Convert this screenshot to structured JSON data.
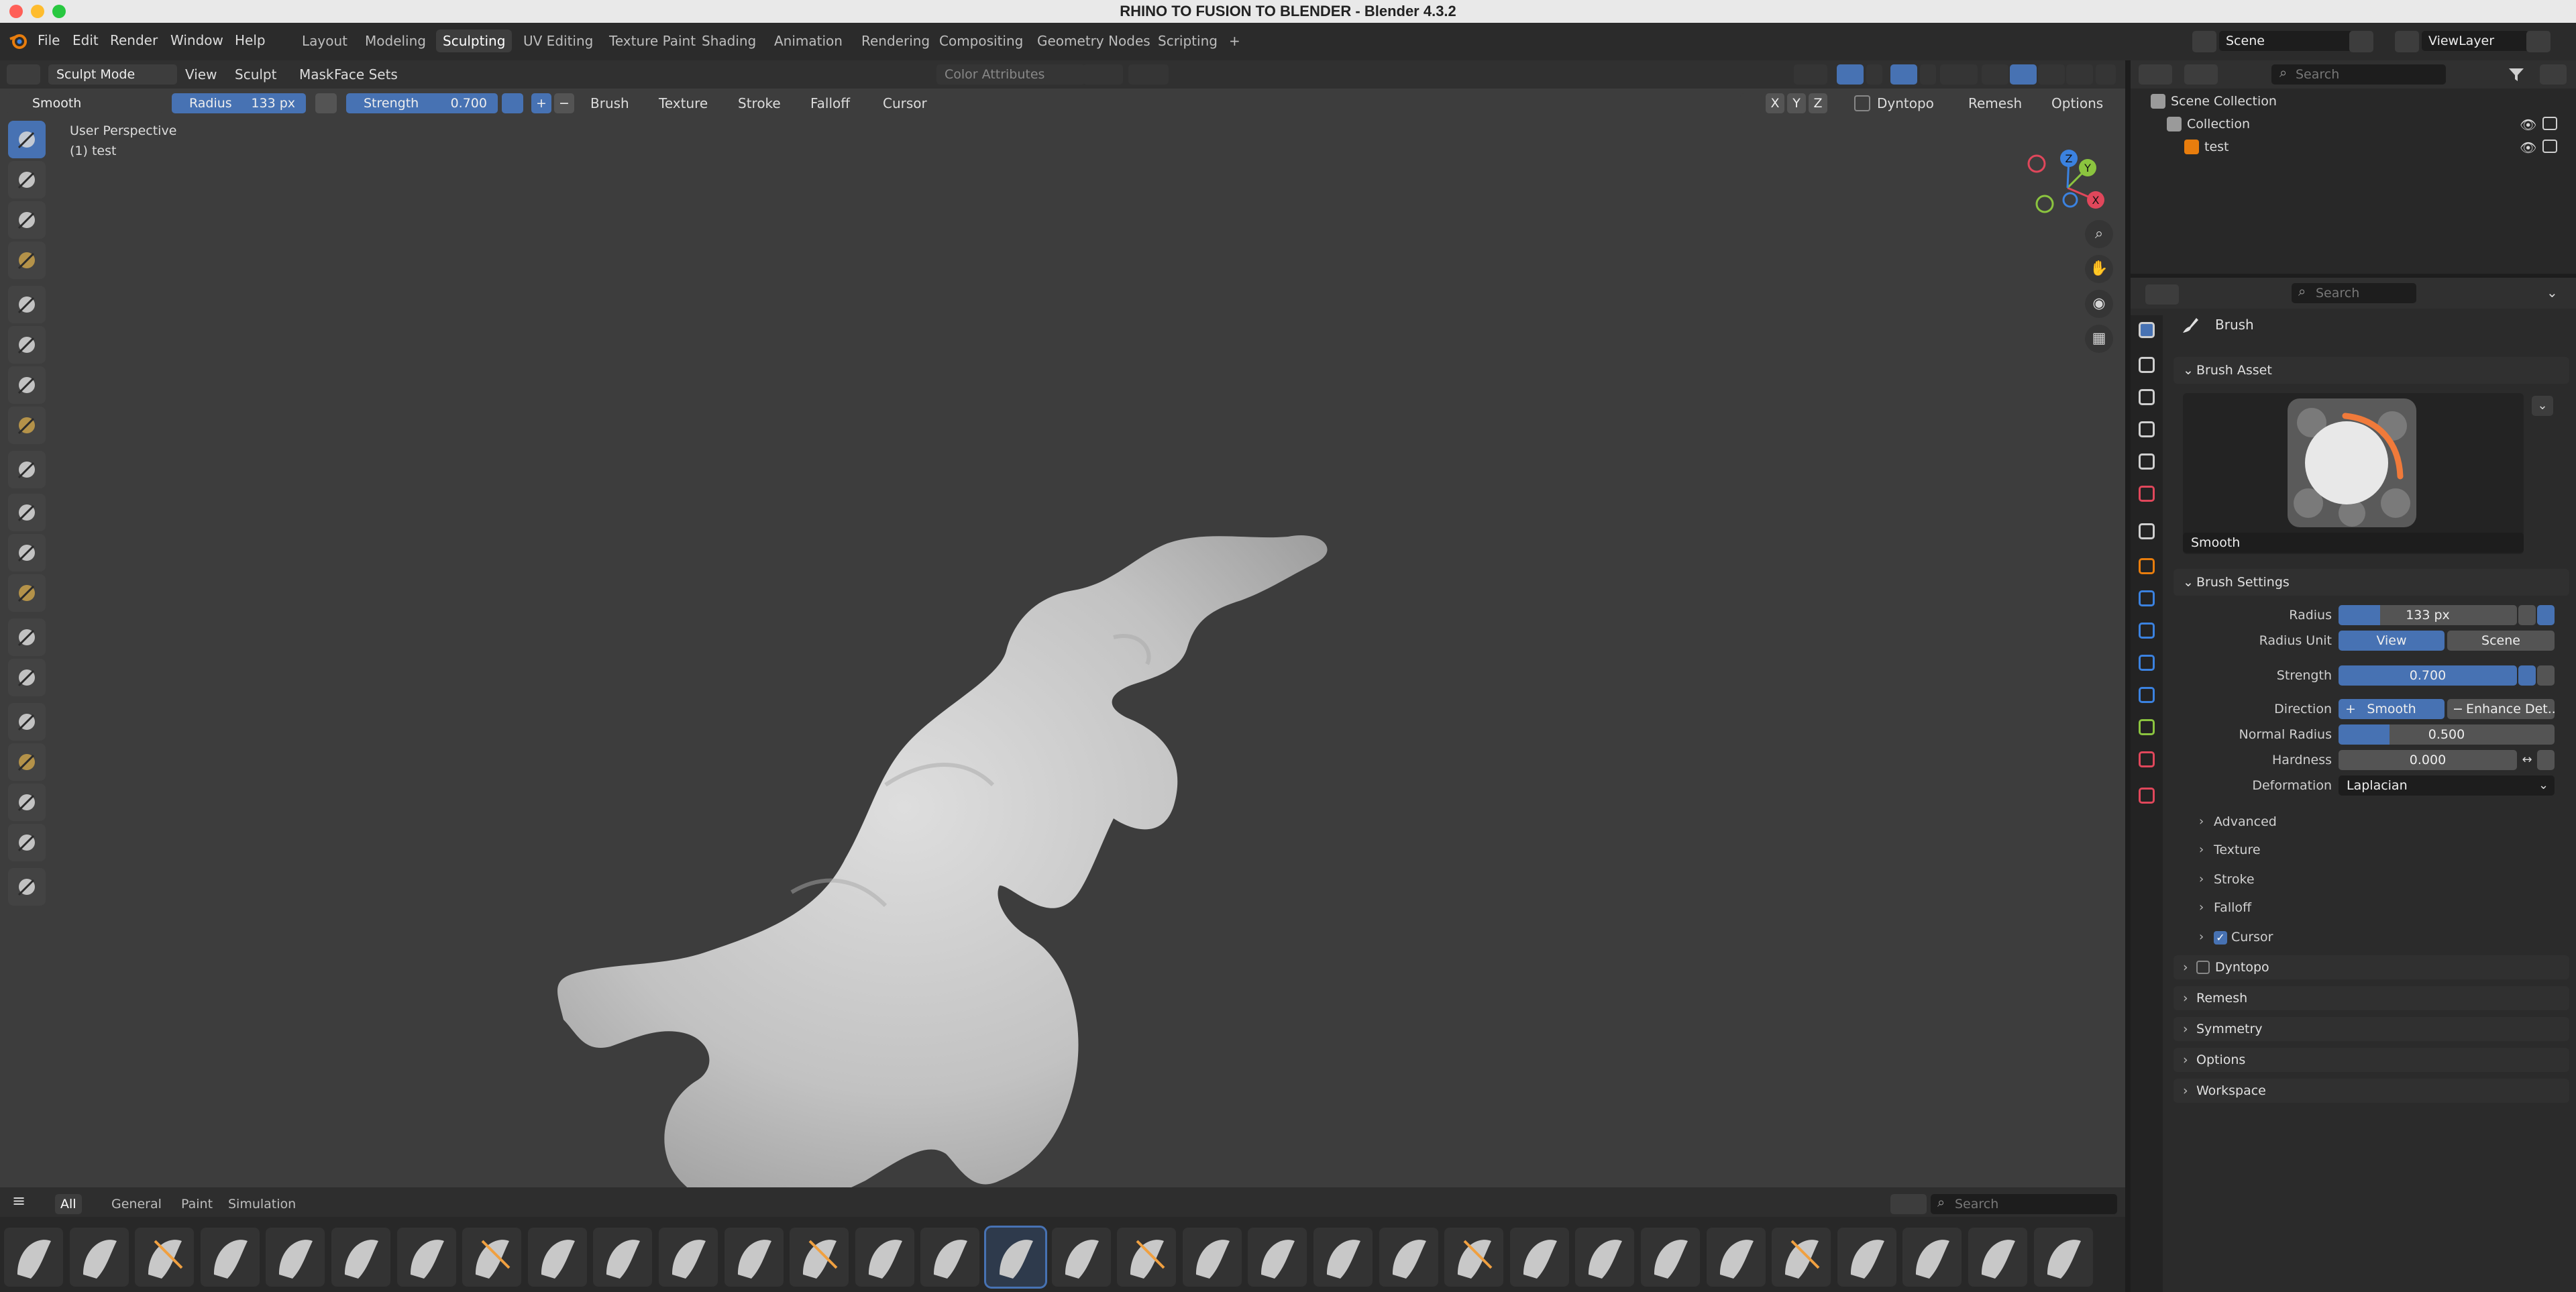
{
  "window": {
    "title": "RHINO TO FUSION TO BLENDER - Blender 4.3.2"
  },
  "menus": [
    "File",
    "Edit",
    "Render",
    "Window",
    "Help"
  ],
  "workspaces": [
    {
      "label": "Layout",
      "active": false
    },
    {
      "label": "Modeling",
      "active": false
    },
    {
      "label": "Sculpting",
      "active": true
    },
    {
      "label": "UV Editing",
      "active": false
    },
    {
      "label": "Texture Paint",
      "active": false
    },
    {
      "label": "Shading",
      "active": false
    },
    {
      "label": "Animation",
      "active": false
    },
    {
      "label": "Rendering",
      "active": false
    },
    {
      "label": "Compositing",
      "active": false
    },
    {
      "label": "Geometry Nodes",
      "active": false
    },
    {
      "label": "Scripting",
      "active": false
    }
  ],
  "add_workspace": "+",
  "scene": {
    "name": "Scene",
    "view_layer": "ViewLayer"
  },
  "viewport_header": {
    "mode": "Sculpt Mode",
    "menus": [
      "View",
      "Sculpt",
      "Mask",
      "Face Sets"
    ],
    "color_attributes": "Color Attributes"
  },
  "tool_header": {
    "brush": "Smooth",
    "radius_label": "Radius",
    "radius_value": "133 px",
    "strength_label": "Strength",
    "strength_value": "0.700",
    "plus": "+",
    "minus": "−",
    "menus": [
      "Brush",
      "Texture",
      "Stroke",
      "Falloff",
      "Cursor"
    ],
    "axes": [
      "X",
      "Y",
      "Z"
    ],
    "dyntopo": "Dyntopo",
    "remesh": "Remesh",
    "options": "Options"
  },
  "viewport_info": {
    "perspective": "User Perspective",
    "object": "(1) test"
  },
  "gizmo": {
    "x": "X",
    "y": "Y",
    "z": "Z"
  },
  "outliner": {
    "search_placeholder": "Search",
    "items": [
      {
        "label": "Scene Collection"
      },
      {
        "label": "Collection"
      },
      {
        "label": "test"
      }
    ]
  },
  "properties": {
    "search_placeholder": "Search",
    "context": "Brush",
    "brush_asset_title": "Brush Asset",
    "asset_name": "Smooth",
    "brush_settings_title": "Brush Settings",
    "rows": {
      "radius": {
        "label": "Radius",
        "value": "133 px"
      },
      "radius_unit": {
        "label": "Radius Unit",
        "opt1": "View",
        "opt2": "Scene"
      },
      "strength": {
        "label": "Strength",
        "value": "0.700"
      },
      "direction": {
        "label": "Direction",
        "opt1": "Smooth",
        "opt2": "Enhance Det..."
      },
      "normal_radius": {
        "label": "Normal Radius",
        "value": "0.500"
      },
      "hardness": {
        "label": "Hardness",
        "value": "0.000"
      },
      "deformation": {
        "label": "Deformation",
        "value": "Laplacian"
      }
    },
    "subpanels": [
      "Advanced",
      "Texture",
      "Stroke",
      "Falloff",
      "Cursor"
    ],
    "panels": [
      "Dyntopo",
      "Remesh",
      "Symmetry",
      "Options",
      "Workspace"
    ]
  },
  "shelf": {
    "tabs": [
      {
        "label": "All",
        "active": true
      },
      {
        "label": "General",
        "active": false
      },
      {
        "label": "Paint",
        "active": false
      },
      {
        "label": "Simulation",
        "active": false
      }
    ],
    "search_placeholder": "Search",
    "thumb_count": 32,
    "active_index": 15
  },
  "colors": {
    "accent": "#4772b3",
    "viewport": "#3d3d3d",
    "mesh": "#c8c8c8",
    "x_axis": "#e0475b",
    "y_axis": "#8bc43f",
    "z_axis": "#3b82e0"
  }
}
